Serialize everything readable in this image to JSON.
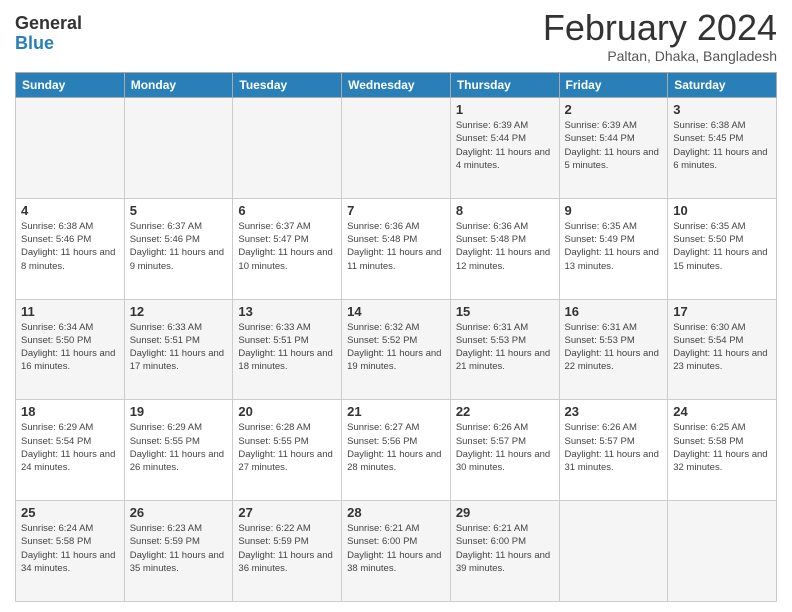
{
  "header": {
    "logo_general": "General",
    "logo_blue": "Blue",
    "month_year": "February 2024",
    "location": "Paltan, Dhaka, Bangladesh"
  },
  "days_of_week": [
    "Sunday",
    "Monday",
    "Tuesday",
    "Wednesday",
    "Thursday",
    "Friday",
    "Saturday"
  ],
  "weeks": [
    [
      {
        "day": "",
        "info": ""
      },
      {
        "day": "",
        "info": ""
      },
      {
        "day": "",
        "info": ""
      },
      {
        "day": "",
        "info": ""
      },
      {
        "day": "1",
        "info": "Sunrise: 6:39 AM\nSunset: 5:44 PM\nDaylight: 11 hours\nand 4 minutes."
      },
      {
        "day": "2",
        "info": "Sunrise: 6:39 AM\nSunset: 5:44 PM\nDaylight: 11 hours\nand 5 minutes."
      },
      {
        "day": "3",
        "info": "Sunrise: 6:38 AM\nSunset: 5:45 PM\nDaylight: 11 hours\nand 6 minutes."
      }
    ],
    [
      {
        "day": "4",
        "info": "Sunrise: 6:38 AM\nSunset: 5:46 PM\nDaylight: 11 hours\nand 8 minutes."
      },
      {
        "day": "5",
        "info": "Sunrise: 6:37 AM\nSunset: 5:46 PM\nDaylight: 11 hours\nand 9 minutes."
      },
      {
        "day": "6",
        "info": "Sunrise: 6:37 AM\nSunset: 5:47 PM\nDaylight: 11 hours\nand 10 minutes."
      },
      {
        "day": "7",
        "info": "Sunrise: 6:36 AM\nSunset: 5:48 PM\nDaylight: 11 hours\nand 11 minutes."
      },
      {
        "day": "8",
        "info": "Sunrise: 6:36 AM\nSunset: 5:48 PM\nDaylight: 11 hours\nand 12 minutes."
      },
      {
        "day": "9",
        "info": "Sunrise: 6:35 AM\nSunset: 5:49 PM\nDaylight: 11 hours\nand 13 minutes."
      },
      {
        "day": "10",
        "info": "Sunrise: 6:35 AM\nSunset: 5:50 PM\nDaylight: 11 hours\nand 15 minutes."
      }
    ],
    [
      {
        "day": "11",
        "info": "Sunrise: 6:34 AM\nSunset: 5:50 PM\nDaylight: 11 hours\nand 16 minutes."
      },
      {
        "day": "12",
        "info": "Sunrise: 6:33 AM\nSunset: 5:51 PM\nDaylight: 11 hours\nand 17 minutes."
      },
      {
        "day": "13",
        "info": "Sunrise: 6:33 AM\nSunset: 5:51 PM\nDaylight: 11 hours\nand 18 minutes."
      },
      {
        "day": "14",
        "info": "Sunrise: 6:32 AM\nSunset: 5:52 PM\nDaylight: 11 hours\nand 19 minutes."
      },
      {
        "day": "15",
        "info": "Sunrise: 6:31 AM\nSunset: 5:53 PM\nDaylight: 11 hours\nand 21 minutes."
      },
      {
        "day": "16",
        "info": "Sunrise: 6:31 AM\nSunset: 5:53 PM\nDaylight: 11 hours\nand 22 minutes."
      },
      {
        "day": "17",
        "info": "Sunrise: 6:30 AM\nSunset: 5:54 PM\nDaylight: 11 hours\nand 23 minutes."
      }
    ],
    [
      {
        "day": "18",
        "info": "Sunrise: 6:29 AM\nSunset: 5:54 PM\nDaylight: 11 hours\nand 24 minutes."
      },
      {
        "day": "19",
        "info": "Sunrise: 6:29 AM\nSunset: 5:55 PM\nDaylight: 11 hours\nand 26 minutes."
      },
      {
        "day": "20",
        "info": "Sunrise: 6:28 AM\nSunset: 5:55 PM\nDaylight: 11 hours\nand 27 minutes."
      },
      {
        "day": "21",
        "info": "Sunrise: 6:27 AM\nSunset: 5:56 PM\nDaylight: 11 hours\nand 28 minutes."
      },
      {
        "day": "22",
        "info": "Sunrise: 6:26 AM\nSunset: 5:57 PM\nDaylight: 11 hours\nand 30 minutes."
      },
      {
        "day": "23",
        "info": "Sunrise: 6:26 AM\nSunset: 5:57 PM\nDaylight: 11 hours\nand 31 minutes."
      },
      {
        "day": "24",
        "info": "Sunrise: 6:25 AM\nSunset: 5:58 PM\nDaylight: 11 hours\nand 32 minutes."
      }
    ],
    [
      {
        "day": "25",
        "info": "Sunrise: 6:24 AM\nSunset: 5:58 PM\nDaylight: 11 hours\nand 34 minutes."
      },
      {
        "day": "26",
        "info": "Sunrise: 6:23 AM\nSunset: 5:59 PM\nDaylight: 11 hours\nand 35 minutes."
      },
      {
        "day": "27",
        "info": "Sunrise: 6:22 AM\nSunset: 5:59 PM\nDaylight: 11 hours\nand 36 minutes."
      },
      {
        "day": "28",
        "info": "Sunrise: 6:21 AM\nSunset: 6:00 PM\nDaylight: 11 hours\nand 38 minutes."
      },
      {
        "day": "29",
        "info": "Sunrise: 6:21 AM\nSunset: 6:00 PM\nDaylight: 11 hours\nand 39 minutes."
      },
      {
        "day": "",
        "info": ""
      },
      {
        "day": "",
        "info": ""
      }
    ]
  ]
}
